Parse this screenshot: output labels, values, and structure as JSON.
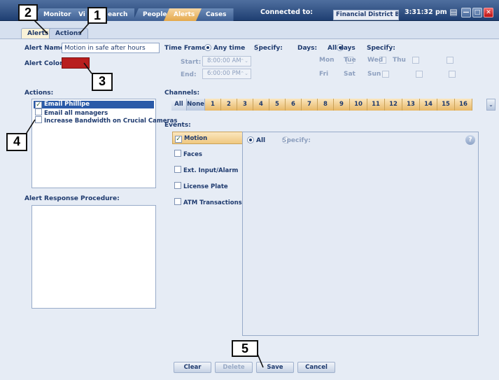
{
  "topbar": {
    "tabs": [
      {
        "label": "Monitor",
        "active": false
      },
      {
        "label": "Vi",
        "active": false
      },
      {
        "label": "earch",
        "active": false
      },
      {
        "label": "People",
        "active": false
      },
      {
        "label": "Alerts",
        "active": true
      },
      {
        "label": "Cases",
        "active": false
      }
    ],
    "connected_label": "Connected to:",
    "connected_value": "Financial District Branch",
    "time": "3:31:32 pm"
  },
  "subtabs": [
    {
      "label": "Alerts",
      "active": true
    },
    {
      "label": "Actions",
      "active": false
    }
  ],
  "form": {
    "alert_name_label": "Alert Name:",
    "alert_name_value": "Motion in safe after hours",
    "alert_color_label": "Alert Color:",
    "alert_color": "#b81e1e",
    "actions_label": "Actions:",
    "actions": [
      {
        "label": "Email Phillipe",
        "checked": true,
        "selected": true
      },
      {
        "label": "Email all managers",
        "checked": false,
        "selected": false
      },
      {
        "label": "Increase Bandwidth on Crucial Cameras",
        "checked": false,
        "selected": false
      }
    ],
    "response_label": "Alert Response Procedure:"
  },
  "timeframe": {
    "label": "Time Frame:",
    "any_time": "Any time",
    "specify": "Specify:",
    "start_label": "Start:",
    "start_value": "8:00:00 AM",
    "end_label": "End:",
    "end_value": "6:00:00 PM"
  },
  "days": {
    "label": "Days:",
    "all_days": "All days",
    "specify": "Specify:",
    "row1": [
      "Mon",
      "Tue",
      "Wed",
      "Thu"
    ],
    "row2": [
      "Fri",
      "Sat",
      "Sun"
    ]
  },
  "channels": {
    "label": "Channels:",
    "all": "All",
    "none": "None",
    "numbers": [
      "1",
      "2",
      "3",
      "4",
      "5",
      "6",
      "7",
      "8",
      "9",
      "10",
      "11",
      "12",
      "13",
      "14",
      "15",
      "16"
    ],
    "more": "⌄"
  },
  "events": {
    "label": "Events:",
    "items": [
      {
        "label": "Motion",
        "checked": true,
        "selected": true
      },
      {
        "label": "Faces",
        "checked": false,
        "selected": false
      },
      {
        "label": "Ext. Input/Alarm",
        "checked": false,
        "selected": false
      },
      {
        "label": "License Plate",
        "checked": false,
        "selected": false
      },
      {
        "label": "ATM Transactions",
        "checked": false,
        "selected": false
      }
    ],
    "all": "All",
    "specify": "Specify:",
    "help": "?"
  },
  "buttons": {
    "clear": "Clear",
    "delete": "Delete",
    "save": "Save",
    "cancel": "Cancel"
  },
  "callouts": [
    "1",
    "2",
    "3",
    "4",
    "5"
  ],
  "glyphs": {
    "spin": "⌃⌄",
    "check": "✓",
    "minimize": "—",
    "maximize": "□",
    "close": "✕",
    "menu": "▤"
  }
}
